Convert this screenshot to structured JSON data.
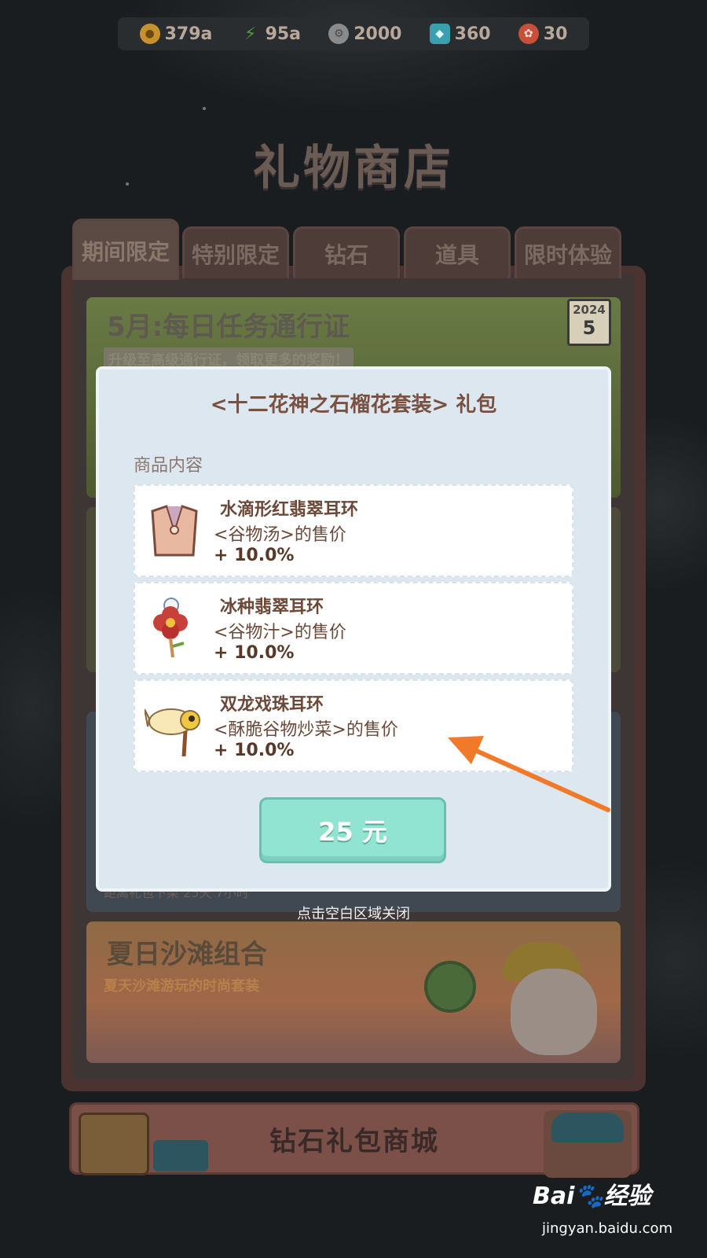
{
  "currencies": [
    {
      "name": "gold-coin",
      "value": "379a",
      "color": "#c8912c"
    },
    {
      "name": "energy",
      "value": "95a",
      "color": "#4a9a3a"
    },
    {
      "name": "silver-gear",
      "value": "2000",
      "color": "#8a8a8a"
    },
    {
      "name": "diamond",
      "value": "360",
      "color": "#3aa0b0"
    },
    {
      "name": "ticket",
      "value": "30",
      "color": "#c8503a"
    }
  ],
  "shop": {
    "title": "礼物商店"
  },
  "tabs": [
    "期间限定",
    "特别限定",
    "钻石",
    "道具",
    "限时体验"
  ],
  "active_tab": "期间限定",
  "cards": {
    "pass": {
      "title": "5月:每日任务通行证",
      "subtitle": "升级至高级通行证，领取更多的奖励！",
      "calendar_year": "2024",
      "calendar_day": "5"
    },
    "beach": {
      "title": "夏日沙滩组合",
      "subtitle": "夏天沙滩游玩的时尚套装"
    },
    "hidden_footer": "距离礼包下架 25天 7小时"
  },
  "banner": {
    "label": "钻石礼包商城"
  },
  "modal": {
    "title": "<十二花神之石榴花套装> 礼包",
    "section_label": "商品内容",
    "items": [
      {
        "name": "水滴形红翡翠耳环",
        "desc": "<谷物汤>的售价",
        "bonus": "+ 10.0%",
        "icon": "vest-icon"
      },
      {
        "name": "冰种翡翠耳环",
        "desc": "<谷物汁>的售价",
        "bonus": "+ 10.0%",
        "icon": "flower-icon"
      },
      {
        "name": "双龙戏珠耳环",
        "desc": "<酥脆谷物炒菜>的售价",
        "bonus": "+ 10.0%",
        "icon": "fish-kite-icon"
      }
    ],
    "price": "25 元",
    "close_hint": "点击空白区域关闭"
  },
  "annotation": {
    "color": "#f07a2a"
  },
  "watermark": {
    "logo": "Bai🐾经验",
    "url": "jingyan.baidu.com"
  }
}
